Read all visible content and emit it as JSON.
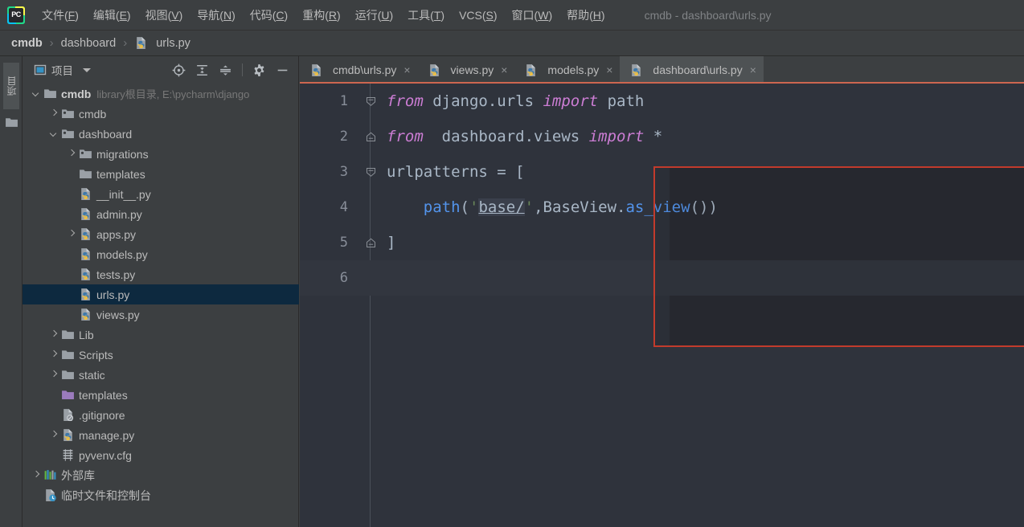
{
  "window": {
    "title": "cmdb - dashboard\\urls.py",
    "app_icon": "pycharm-logo-icon"
  },
  "menubar": {
    "items": [
      {
        "text": "文件",
        "mnemonic": "F"
      },
      {
        "text": "编辑",
        "mnemonic": "E"
      },
      {
        "text": "视图",
        "mnemonic": "V"
      },
      {
        "text": "导航",
        "mnemonic": "N"
      },
      {
        "text": "代码",
        "mnemonic": "C"
      },
      {
        "text": "重构",
        "mnemonic": "R"
      },
      {
        "text": "运行",
        "mnemonic": "U"
      },
      {
        "text": "工具",
        "mnemonic": "T"
      },
      {
        "text": "VCS",
        "mnemonic": "S"
      },
      {
        "text": "窗口",
        "mnemonic": "W"
      },
      {
        "text": "帮助",
        "mnemonic": "H"
      }
    ]
  },
  "breadcrumb": {
    "root": "cmdb",
    "folder": "dashboard",
    "file": "urls.py",
    "separator": "›"
  },
  "toolstrip": {
    "project_label": "项目",
    "folder_icon": "folder-icon"
  },
  "project_panel": {
    "title": "项目",
    "dropdown_icon": "chevron-down-icon",
    "actions": [
      {
        "name": "locate-icon",
        "title": "定位"
      },
      {
        "name": "expand-all-icon",
        "title": "全部展开"
      },
      {
        "name": "collapse-all-icon",
        "title": "全部折叠"
      },
      {
        "name": "settings-gear-icon",
        "title": "设置"
      },
      {
        "name": "hide-panel-icon",
        "title": "隐藏"
      }
    ],
    "tree": [
      {
        "label": "cmdb",
        "note": "library根目录, E:\\pycharm\\django",
        "indent": 0,
        "arrow": "down",
        "icon": "folder-root",
        "bold": true,
        "selected": false
      },
      {
        "label": "cmdb",
        "note": "",
        "indent": 1,
        "arrow": "right",
        "icon": "folder-module",
        "bold": false,
        "selected": false
      },
      {
        "label": "dashboard",
        "note": "",
        "indent": 1,
        "arrow": "down",
        "icon": "folder-module",
        "bold": false,
        "selected": false
      },
      {
        "label": "migrations",
        "note": "",
        "indent": 2,
        "arrow": "right",
        "icon": "folder-module",
        "bold": false,
        "selected": false
      },
      {
        "label": "templates",
        "note": "",
        "indent": 2,
        "arrow": "none",
        "icon": "folder-plain",
        "bold": false,
        "selected": false
      },
      {
        "label": "__init__.py",
        "note": "",
        "indent": 2,
        "arrow": "none",
        "icon": "python-file",
        "bold": false,
        "selected": false
      },
      {
        "label": "admin.py",
        "note": "",
        "indent": 2,
        "arrow": "none",
        "icon": "python-file",
        "bold": false,
        "selected": false
      },
      {
        "label": "apps.py",
        "note": "",
        "indent": 2,
        "arrow": "right",
        "icon": "python-file",
        "bold": false,
        "selected": false
      },
      {
        "label": "models.py",
        "note": "",
        "indent": 2,
        "arrow": "none",
        "icon": "python-file",
        "bold": false,
        "selected": false
      },
      {
        "label": "tests.py",
        "note": "",
        "indent": 2,
        "arrow": "none",
        "icon": "python-file",
        "bold": false,
        "selected": false
      },
      {
        "label": "urls.py",
        "note": "",
        "indent": 2,
        "arrow": "none",
        "icon": "python-file",
        "bold": false,
        "selected": true
      },
      {
        "label": "views.py",
        "note": "",
        "indent": 2,
        "arrow": "none",
        "icon": "python-file",
        "bold": false,
        "selected": false
      },
      {
        "label": "Lib",
        "note": "",
        "indent": 1,
        "arrow": "right",
        "icon": "folder-plain",
        "bold": false,
        "selected": false
      },
      {
        "label": "Scripts",
        "note": "",
        "indent": 1,
        "arrow": "right",
        "icon": "folder-plain",
        "bold": false,
        "selected": false
      },
      {
        "label": "static",
        "note": "",
        "indent": 1,
        "arrow": "right",
        "icon": "folder-plain",
        "bold": false,
        "selected": false
      },
      {
        "label": "templates",
        "note": "",
        "indent": 1,
        "arrow": "none",
        "icon": "folder-template",
        "bold": false,
        "selected": false
      },
      {
        "label": ".gitignore",
        "note": "",
        "indent": 1,
        "arrow": "none",
        "icon": "gitignore-file",
        "bold": false,
        "selected": false
      },
      {
        "label": "manage.py",
        "note": "",
        "indent": 1,
        "arrow": "right",
        "icon": "python-file",
        "bold": false,
        "selected": false
      },
      {
        "label": "pyvenv.cfg",
        "note": "",
        "indent": 1,
        "arrow": "none",
        "icon": "cfg-file",
        "bold": false,
        "selected": false
      },
      {
        "label": "外部库",
        "note": "",
        "indent": 0,
        "arrow": "right",
        "icon": "external-libraries",
        "bold": false,
        "selected": false
      },
      {
        "label": "临时文件和控制台",
        "note": "",
        "indent": 0,
        "arrow": "none",
        "icon": "scratches",
        "bold": false,
        "selected": false
      }
    ]
  },
  "editor": {
    "tabs": [
      {
        "label": "cmdb\\urls.py",
        "active": false,
        "icon": "python-file",
        "close": "×"
      },
      {
        "label": "views.py",
        "active": false,
        "icon": "python-file",
        "close": "×"
      },
      {
        "label": "models.py",
        "active": false,
        "icon": "python-file",
        "close": "×"
      },
      {
        "label": "dashboard\\urls.py",
        "active": true,
        "icon": "python-file",
        "close": "×"
      }
    ],
    "lines": [
      {
        "num": "1",
        "fold": "expanded",
        "current": false
      },
      {
        "num": "2",
        "fold": "end",
        "current": false
      },
      {
        "num": "3",
        "fold": "expanded",
        "current": false
      },
      {
        "num": "4",
        "fold": "none",
        "current": false
      },
      {
        "num": "5",
        "fold": "end",
        "current": false
      },
      {
        "num": "6",
        "fold": "none",
        "current": true
      }
    ],
    "code": {
      "l1_kw1": "from",
      "l1_mod": " django.urls ",
      "l1_kw2": "import",
      "l1_tail": " path",
      "l2_kw1": "from",
      "l2_mod": "  dashboard.views ",
      "l2_kw2": "import",
      "l2_tail": " *",
      "l3": "urlpatterns = [",
      "l4_indent": "    ",
      "l4_fn": "path",
      "l4_p1": "(",
      "l4_q1": "'",
      "l4_ref": "base/",
      "l4_q2": "'",
      "l4_mid": ",BaseView.",
      "l4_fn2": "as_view",
      "l4_end": "())",
      "l5": "]",
      "l6": ""
    },
    "colors": {
      "keyword": "#cc7dd4",
      "function": "#5394ec",
      "string": "#6a8759",
      "plain": "#a9b7c6",
      "background": "#2f333c",
      "annotation_box": "#c23b2c",
      "active_tab_underline": "#cd6650",
      "selection": "#0d293f"
    }
  }
}
